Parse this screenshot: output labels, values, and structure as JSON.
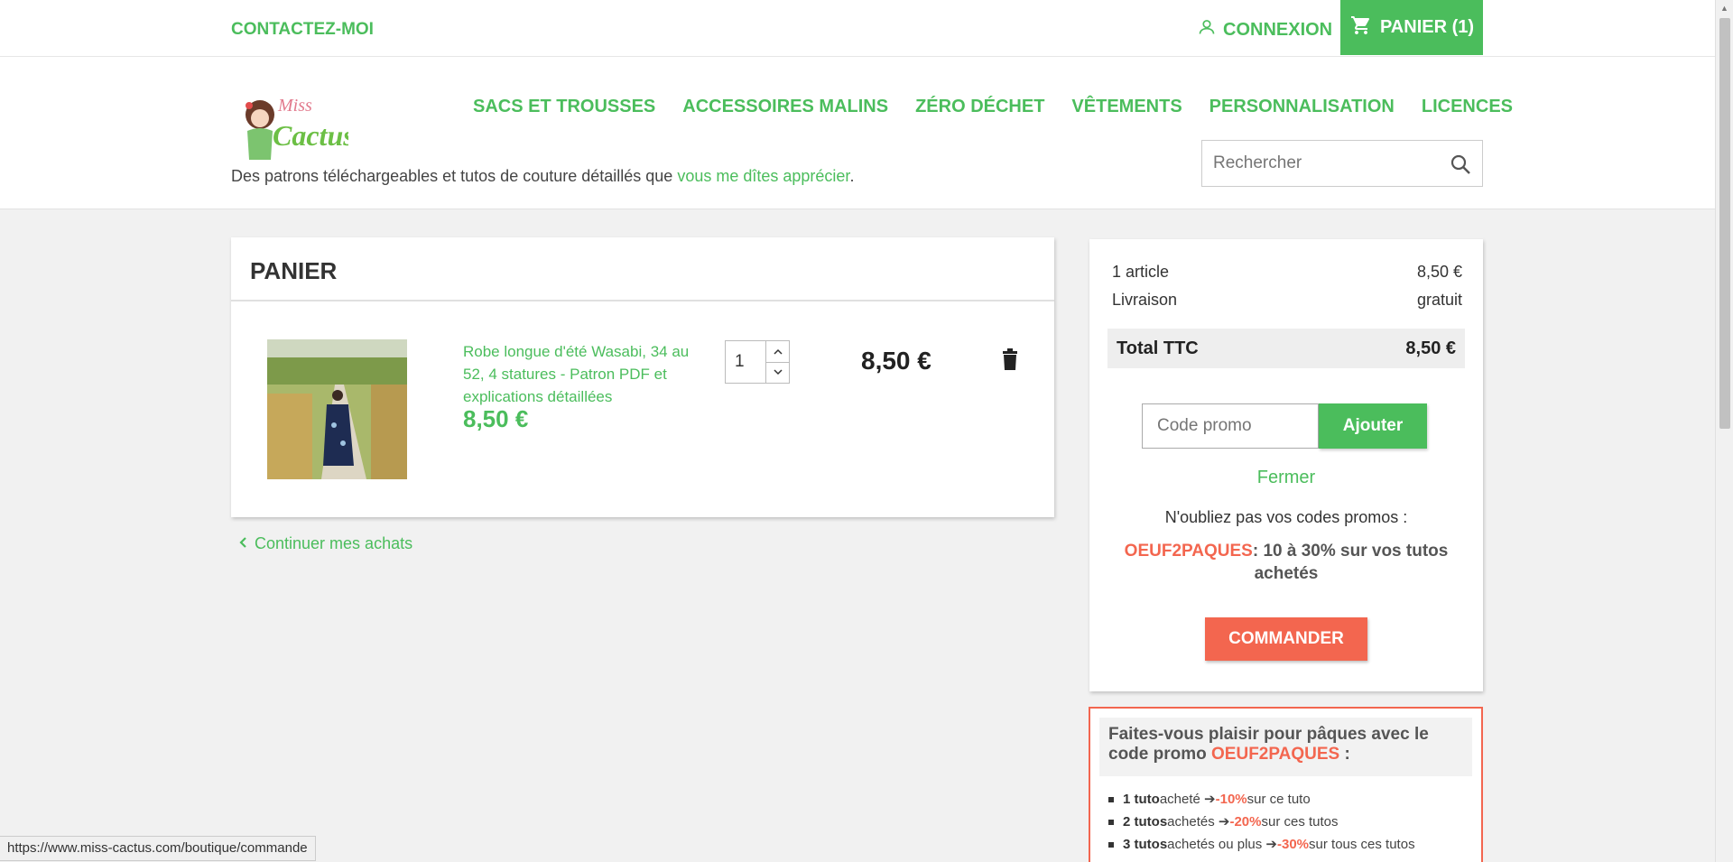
{
  "topbar": {
    "contact": "CONTACTEZ-MOI",
    "login": "CONNEXION",
    "cart": "PANIER (1)"
  },
  "header": {
    "logo_alt": "Miss-Cactus",
    "tagline_prefix": "Des patrons téléchargeables et tutos de couture détaillés que ",
    "tagline_link": "vous me dîtes apprécier",
    "tagline_suffix": ".",
    "nav": [
      "SACS ET TROUSSES",
      "ACCESSOIRES MALINS",
      "ZÉRO DÉCHET",
      "VÊTEMENTS",
      "PERSONNALISATION",
      "LICENCES"
    ],
    "search_placeholder": "Rechercher"
  },
  "cart": {
    "title": "PANIER",
    "item": {
      "name": "Robe longue d'été Wasabi, 34 au 52, 4 statures - Patron PDF et explications détaillées",
      "price": "8,50 €",
      "quantity": "1",
      "line_total": "8,50 €"
    },
    "continue": "Continuer mes achats"
  },
  "summary": {
    "items_label": "1 article",
    "items_value": "8,50 €",
    "shipping_label": "Livraison",
    "shipping_value": "gratuit",
    "total_label": "Total TTC",
    "total_value": "8,50 €",
    "promo_placeholder": "Code promo",
    "promo_button": "Ajouter",
    "close": "Fermer",
    "reminder": "N'oubliez pas vos codes promos :",
    "code": "OEUF2PAQUES",
    "code_desc": ": 10 à 30% sur vos tutos achetés",
    "order_button": "COMMANDER"
  },
  "easter": {
    "title_prefix": "Faites-vous plaisir pour pâques avec le code promo ",
    "title_code": "OEUF2PAQUES",
    "title_suffix": " :",
    "rows": [
      {
        "count": "1 tuto",
        "verb": " acheté ➔ ",
        "pct": "-10%",
        "rest": " sur ce tuto"
      },
      {
        "count": "2 tutos",
        "verb": " achetés ➔ ",
        "pct": "-20%",
        "rest": " sur ces tutos"
      },
      {
        "count": "3 tutos",
        "verb": " achetés ou plus ➔ ",
        "pct": "-30%",
        "rest": " sur tous ces tutos"
      }
    ]
  },
  "statusbar": {
    "url": "https://www.miss-cactus.com/boutique/commande"
  },
  "colors": {
    "brand_green": "#4bbd5c",
    "accent_red": "#f3664f"
  }
}
